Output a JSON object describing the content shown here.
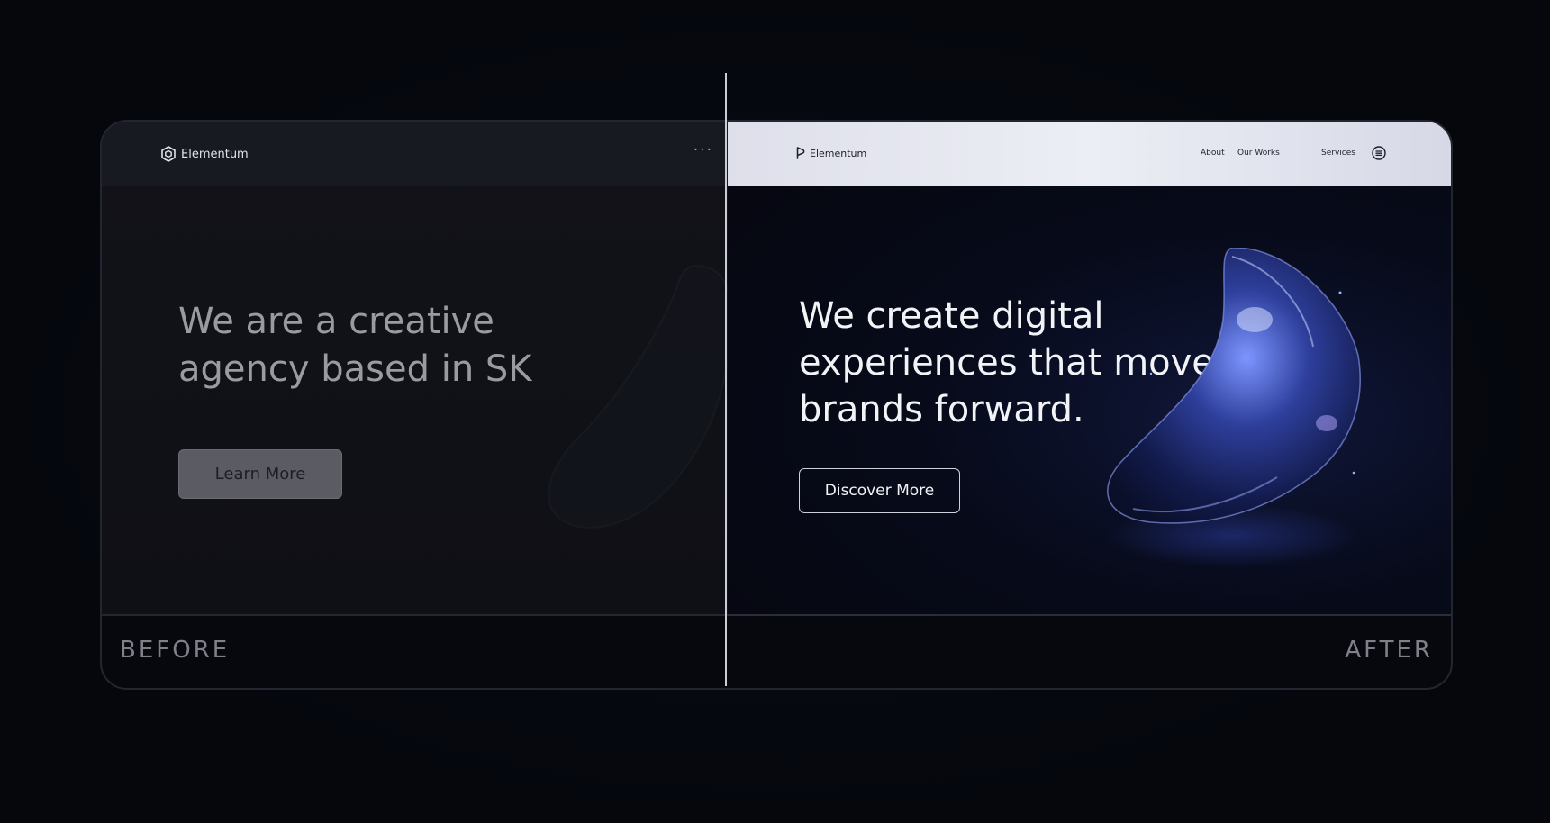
{
  "before": {
    "brand": "Elementum",
    "more_icon": "···",
    "headline": "We are a creative agency based in SK",
    "cta": "Learn More",
    "label": "BEFORE"
  },
  "after": {
    "brand": "Elementum",
    "nav": [
      "About",
      "Our Works",
      "Services"
    ],
    "headline": "We create digital experiences that move brands forward.",
    "cta": "Discover More",
    "label": "AFTER"
  },
  "colors": {
    "background": "#05070d",
    "after_accent": "#3a4fc0",
    "after_nav_bg": "#e4e6ef"
  }
}
